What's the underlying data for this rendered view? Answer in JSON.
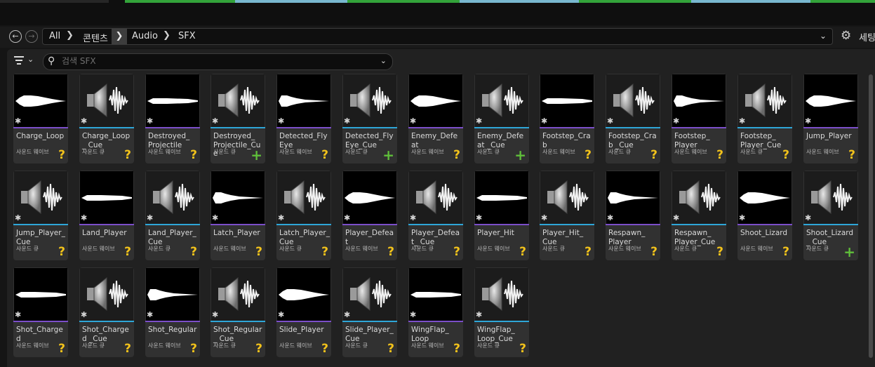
{
  "breadcrumb": {
    "items": [
      "All",
      "콘텐츠",
      "Audio",
      "SFX"
    ]
  },
  "settings_label": "세팅",
  "search": {
    "placeholder": "검색 SFX"
  },
  "colors": {
    "sound_wave_bar": "#7b4ec9",
    "sound_cue_bar": "#2ea6d8",
    "question_badge": "#f2c21b",
    "plus_badge": "#5fbf3a"
  },
  "assets": [
    {
      "name": "Charge_Loop",
      "type": "사운드 웨이브",
      "kind": "wave",
      "badge": "?"
    },
    {
      "name": "Charge_Loop_ Cue",
      "type": "사운드 큐",
      "kind": "cue",
      "badge": "?"
    },
    {
      "name": "Destroyed_ Projectile",
      "type": "사운드 웨이브",
      "kind": "wave",
      "badge": "?"
    },
    {
      "name": "Destroyed_ Projectile_Cue",
      "type": "사운드 큐",
      "kind": "cue",
      "badge": "+"
    },
    {
      "name": "Detected_Fly Eye",
      "type": "사운드 웨이브",
      "kind": "wave",
      "badge": "?"
    },
    {
      "name": "Detected_Fly Eye_Cue",
      "type": "사운드 큐",
      "kind": "cue",
      "badge": "+"
    },
    {
      "name": "Enemy_Defeat",
      "type": "사운드 웨이브",
      "kind": "wave",
      "badge": "?"
    },
    {
      "name": "Enemy_Defeat _Cue",
      "type": "사운드 큐",
      "kind": "cue",
      "badge": "+"
    },
    {
      "name": "Footstep_Crab",
      "type": "사운드 웨이브",
      "kind": "wave",
      "badge": "?"
    },
    {
      "name": "Footstep_Crab _Cue",
      "type": "사운드 큐",
      "kind": "cue",
      "badge": "?"
    },
    {
      "name": "Footstep_ Player",
      "type": "사운드 웨이브",
      "kind": "wave",
      "badge": "?"
    },
    {
      "name": "Footstep_ Player_Cue",
      "type": "사운드 큐",
      "kind": "cue",
      "badge": "?"
    },
    {
      "name": "Jump_Player",
      "type": "사운드 웨이브",
      "kind": "wave",
      "badge": "?"
    },
    {
      "name": "Jump_Player_ Cue",
      "type": "사운드 큐",
      "kind": "cue",
      "badge": "?"
    },
    {
      "name": "Land_Player",
      "type": "사운드 웨이브",
      "kind": "wave",
      "badge": "?"
    },
    {
      "name": "Land_Player_ Cue",
      "type": "사운드 큐",
      "kind": "cue",
      "badge": "?"
    },
    {
      "name": "Latch_Player",
      "type": "사운드 웨이브",
      "kind": "wave",
      "badge": "?"
    },
    {
      "name": "Latch_Player_ Cue",
      "type": "사운드 큐",
      "kind": "cue",
      "badge": "?"
    },
    {
      "name": "Player_Defeat",
      "type": "사운드 웨이브",
      "kind": "wave",
      "badge": "?"
    },
    {
      "name": "Player_Defeat_ Cue",
      "type": "사운드 큐",
      "kind": "cue",
      "badge": "?"
    },
    {
      "name": "Player_Hit",
      "type": "사운드 웨이브",
      "kind": "wave",
      "badge": "?"
    },
    {
      "name": "Player_Hit_ Cue",
      "type": "사운드 큐",
      "kind": "cue",
      "badge": "?"
    },
    {
      "name": "Respawn_ Player",
      "type": "사운드 웨이브",
      "kind": "wave",
      "badge": "?"
    },
    {
      "name": "Respawn_ Player_Cue",
      "type": "사운드 큐",
      "kind": "cue",
      "badge": "?"
    },
    {
      "name": "Shoot_Lizard",
      "type": "사운드 웨이브",
      "kind": "wave",
      "badge": "?"
    },
    {
      "name": "Shoot_Lizard_ Cue",
      "type": "사운드 큐",
      "kind": "cue",
      "badge": "+"
    },
    {
      "name": "Shot_Charged",
      "type": "사운드 웨이브",
      "kind": "wave",
      "badge": "?"
    },
    {
      "name": "Shot_Charged _Cue",
      "type": "사운드 큐",
      "kind": "cue",
      "badge": "?"
    },
    {
      "name": "Shot_Regular",
      "type": "사운드 웨이브",
      "kind": "wave",
      "badge": "?"
    },
    {
      "name": "Shot_Regular_ Cue",
      "type": "사운드 큐",
      "kind": "cue",
      "badge": "?"
    },
    {
      "name": "Slide_Player",
      "type": "사운드 웨이브",
      "kind": "wave",
      "badge": "?"
    },
    {
      "name": "Slide_Player_ Cue",
      "type": "사운드 큐",
      "kind": "cue",
      "badge": "?"
    },
    {
      "name": "WingFlap_ Loop",
      "type": "사운드 웨이브",
      "kind": "wave",
      "badge": "?"
    },
    {
      "name": "WingFlap_ Loop_Cue",
      "type": "사운드 큐",
      "kind": "cue",
      "badge": "?"
    }
  ]
}
